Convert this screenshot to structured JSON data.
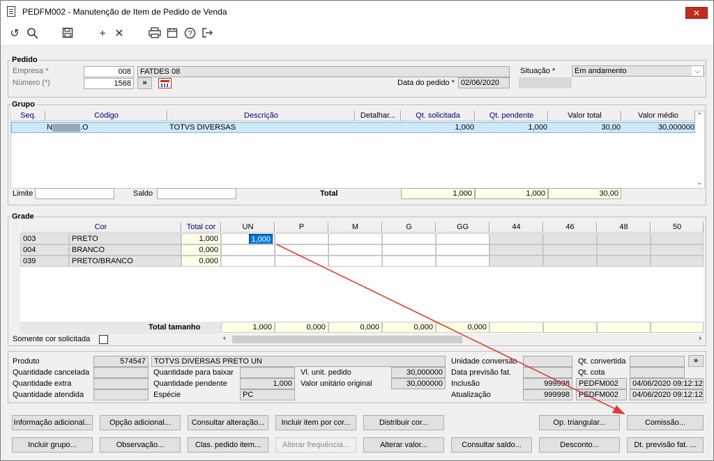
{
  "window": {
    "title": "PEDFM002 - Manutenção de Item de Pedido de Venda",
    "close": "✕"
  },
  "toolbar": {
    "icons": [
      "undo-icon",
      "search-icon",
      "save-icon",
      "add-icon",
      "delete-icon",
      "print-icon",
      "calendar-icon",
      "help-icon",
      "exit-icon"
    ]
  },
  "pedido": {
    "title": "Pedido",
    "empresa_label": "Empresa *",
    "empresa_value": "008",
    "empresa_name": "FATDES 08",
    "numero_label": "Número (*)",
    "numero_value": "1568",
    "nav_button": "»",
    "data_label": "Data do pedido *",
    "data_value": "02/06/2020",
    "situacao_label": "Situação *",
    "situacao_value": "Em andamento"
  },
  "grupo": {
    "title": "Grupo",
    "headers": [
      "Seq.",
      "Código",
      "Descrição",
      "Detalhar...",
      "Qt. solicitada",
      "Qt. pendente",
      "Valor total",
      "Valor médio"
    ],
    "row": {
      "seq": "",
      "codigo": "N",
      "codigo_tail": ".O",
      "descricao": "TOTVS DIVERSAS",
      "detalhar": "",
      "qt_solicitada": "1,000",
      "qt_pendente": "1,000",
      "valor_total": "30,00",
      "valor_medio": "30,000000"
    },
    "limite_label": "Limite",
    "saldo_label": "Saldo",
    "total_label": "Total",
    "total_qt_solicitada": "1,000",
    "total_qt_pendente": "1,000",
    "total_valor": "30,00"
  },
  "grade": {
    "title": "Grade",
    "headers": [
      "Cor",
      "Total cor",
      "UN",
      "P",
      "M",
      "G",
      "GG",
      "44",
      "46",
      "48",
      "50"
    ],
    "rows": [
      {
        "code": "003",
        "name": "PRETO",
        "total": "1,000",
        "un": "1,000"
      },
      {
        "code": "004",
        "name": "BRANCO",
        "total": "0,000",
        "un": ""
      },
      {
        "code": "039",
        "name": "PRETO/BRANCO",
        "total": "0,000",
        "un": ""
      }
    ],
    "total_tamanho_label": "Total tamanho",
    "totals": [
      "1,000",
      "0,000",
      "0,000",
      "0,000",
      "0,000"
    ],
    "somente_label": "Somente cor solicitada"
  },
  "produto": {
    "produto_label": "Produto",
    "produto_code": "574547",
    "produto_name": "TOTVS DIVERSAS PRETO UN",
    "qt_cancelada_label": "Quantidade cancelada",
    "qt_extra_label": "Quantidade extra",
    "qt_atendida_label": "Quantidade atendida",
    "qt_baixar_label": "Quantidade para baixar",
    "qt_pendente_label": "Quantidade pendente",
    "qt_pendente_value": "1,000",
    "especie_label": "Espécie",
    "especie_value": "PC",
    "vl_unit_label": "Vl. unit. pedido",
    "vl_unit_value": "30,000000",
    "vl_orig_label": "Valor unitário original",
    "vl_orig_value": "30,000000",
    "unid_conv_label": "Unidade conversão",
    "data_prev_label": "Data previsão fat.",
    "inclusao_label": "Inclusão",
    "inclusao_code": "999998",
    "inclusao_prog": "PEDFM002",
    "inclusao_dt": "04/06/2020 09:12:12",
    "atualizacao_label": "Atualização",
    "atualizacao_code": "999998",
    "atualizacao_prog": "PEDFM002",
    "atualizacao_dt": "04/06/2020 09:12:12",
    "qt_convertida_label": "Qt. convertida",
    "qt_cota_label": "Qt. cota",
    "more_button": "»"
  },
  "buttons": {
    "info_adicional": "Informação adicional...",
    "opcao_adicional": "Opção adicional...",
    "consultar_alteracao": "Consultar alteração...",
    "incluir_item_cor": "Incluir item por cor...",
    "distribuir_cor": "Distribuir cor...",
    "op_triangular": "Op. triangular...",
    "comissao": "Comissão...",
    "incluir_grupo": "Incluir grupo...",
    "observacao": "Observação...",
    "clas_pedido": "Clas. pedido item...",
    "alterar_frequencia": "Alterar frequência...",
    "alterar_valor": "Alterar valor...",
    "consultar_saldo": "Consultar saldo...",
    "desconto": "Desconto...",
    "dt_previsao": "Dt. previsão fat. ..."
  },
  "colors": {
    "accent": "#0078d7",
    "annotation_arrow": "#e53935",
    "close": "#c42b1c"
  }
}
